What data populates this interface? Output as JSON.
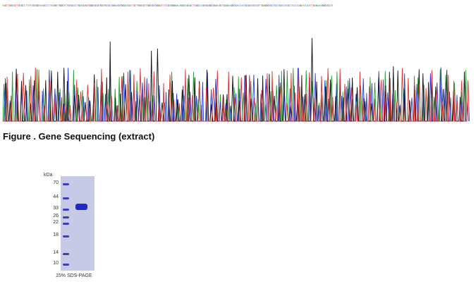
{
  "sequence_strip": {
    "text": "TAGTTGGCGTTGCGCCTTATCGCGGTACGCCCTACGGCTGGGTCTGCGACCTGACGAGTGGGCGCGTGGTGCGCCGGACGCGGGACGATTGTTGGCGTTGGCGCCGGGATTCCGCGGGGACAGGCAGCGCTCGGCCAGCGAGGCGGACGCTGAGACGGCGACCACCGCGACGCCGTTGAGGGCGCCGCCGACCACGCTACCCAGATCCAATTGAGAACGGGCGCAT",
    "colors": {
      "A": "#1fa030",
      "C": "#2a3ae0",
      "G": "#111111",
      "T": "#e03030"
    }
  },
  "chromatogram": {
    "trace_colors": [
      "#1fa030",
      "#2a3ae0",
      "#111111",
      "#e03030"
    ]
  },
  "caption": "Figure . Gene Sequencing (extract)",
  "gel": {
    "unit_label": "kDa",
    "markers": [
      "70",
      "44",
      "33",
      "26",
      "22",
      "18",
      "14",
      "10"
    ],
    "lane_caption": "15% SDS-PAGE",
    "colors": {
      "gel": "#c7c9e7",
      "ladder": "#3940b8",
      "sample": "#1f28c8"
    }
  }
}
